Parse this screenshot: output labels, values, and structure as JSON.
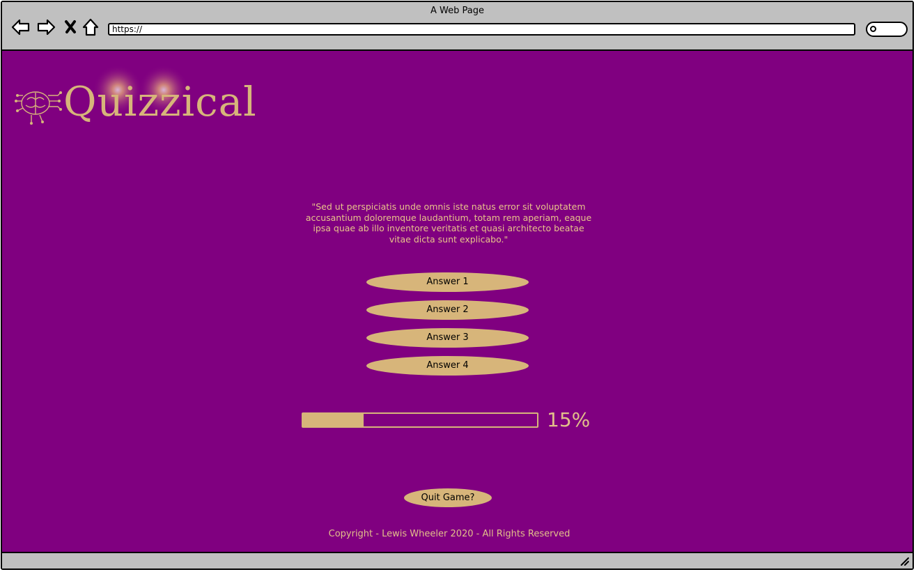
{
  "browser": {
    "title": "A Web Page",
    "url": "https://"
  },
  "page": {
    "logo_text": "Quizzical",
    "question": "\"Sed ut perspiciatis unde omnis iste natus error sit voluptatem accusantium doloremque laudantium, totam rem aperiam, eaque ipsa quae ab illo inventore veritatis et quasi architecto beatae vitae dicta sunt explicabo.\"",
    "answers": [
      "Answer 1",
      "Answer 2",
      "Answer 3",
      "Answer 4"
    ],
    "progress": {
      "fraction": 0.26,
      "label": "15%"
    },
    "quit_label": "Quit Game?",
    "footer": "Copyright - Lewis Wheeler 2020 - All Rights Reserved"
  },
  "colors": {
    "background": "#800080",
    "accent": "#d7b57a",
    "text": "#e2c08a"
  },
  "icons": [
    "back-icon",
    "forward-icon",
    "close-icon",
    "home-icon",
    "search-icon",
    "resize-grip-icon",
    "brain-circuit-icon"
  ]
}
